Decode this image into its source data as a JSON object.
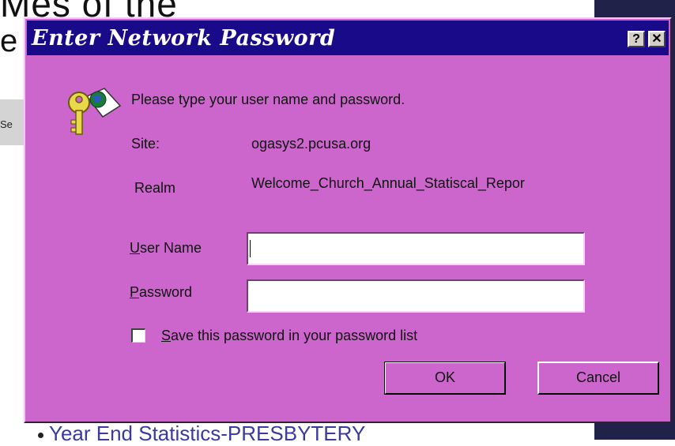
{
  "background": {
    "heading_fragment": "Mes of the",
    "left_fragment": "e",
    "side_fragment": "Se",
    "bottom_link": "Year End Statistics-PRESBYTERY"
  },
  "dialog": {
    "title": "Enter Network Password",
    "help_button": "?",
    "close_button": "✕",
    "prompt": "Please type your user name and password.",
    "site_label": "Site:",
    "site_value": "ogasys2.pcusa.org",
    "realm_label": "Realm",
    "realm_value": "Welcome_Church_Annual_Statiscal_Repor",
    "username_label_u": "U",
    "username_label_rest": "ser Name",
    "username_value": "",
    "password_label_u": "P",
    "password_label_rest": "assword",
    "password_value": "",
    "save_password_u": "S",
    "save_password_rest": "ave this password in your password list",
    "save_password_checked": false,
    "ok_label": "OK",
    "cancel_label": "Cancel"
  },
  "colors": {
    "dialog_bg": "#cc66cc",
    "titlebar_bg": "#190a8a"
  },
  "icons": {
    "keys": "keys-globe-icon"
  }
}
